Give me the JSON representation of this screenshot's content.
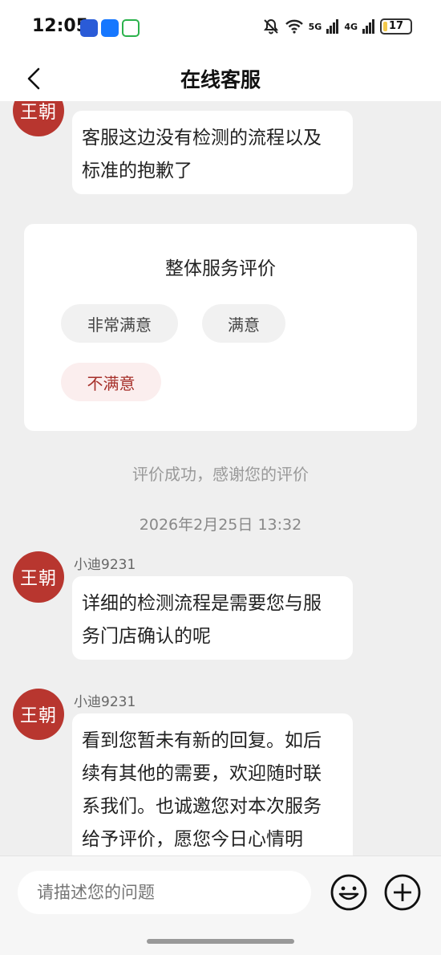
{
  "status_bar": {
    "time": "12:05",
    "signal_1": "5G",
    "signal_2": "4G",
    "battery": "17"
  },
  "header": {
    "title": "在线客服"
  },
  "messages": [
    {
      "avatar_text": "王朝",
      "text_line1": "客服这边没有检测的流程以及",
      "text_line2": "标准的抱歉了"
    },
    {
      "avatar_text": "王朝",
      "sender": "小迪9231",
      "text_line1": "详细的检测流程是需要您与服",
      "text_line2": "务门店确认的呢"
    },
    {
      "avatar_text": "王朝",
      "sender": "小迪9231",
      "text_line1": "看到您暂未有新的回复。如后",
      "text_line2": "续有其他的需要，欢迎随时联",
      "text_line3": "系我们。也诚邀您对本次服务",
      "text_line4": "给予评价，愿您今日心情明"
    }
  ],
  "rating": {
    "title": "整体服务评价",
    "options": [
      "非常满意",
      "满意",
      "不满意"
    ],
    "selected": "不满意"
  },
  "system_note": "评价成功，感谢您的评价",
  "timestamp": "2026年2月25日 13:32",
  "input": {
    "placeholder": "请描述您的问题"
  },
  "icons": [
    "back-icon",
    "emoji-icon",
    "plus-icon",
    "mute-icon",
    "wifi-icon",
    "battery-icon"
  ],
  "colors": {
    "accent": "#b8362f",
    "background": "#efefef"
  }
}
